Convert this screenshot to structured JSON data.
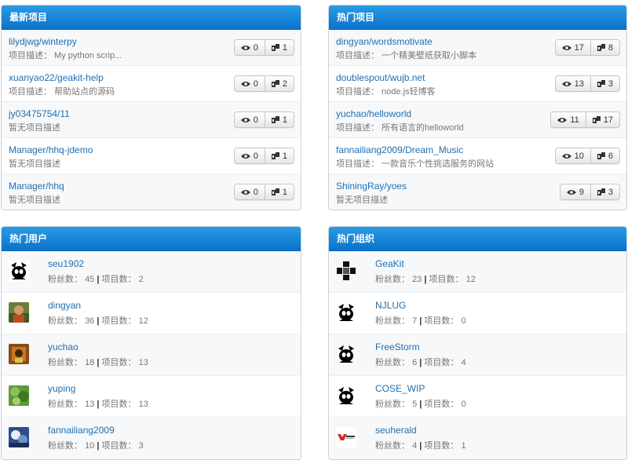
{
  "colors": {
    "header_top": "#2a9be4",
    "header_bottom": "#0a72cc",
    "link": "#1f6fb2"
  },
  "latest": {
    "title": "最新项目",
    "items": [
      {
        "name": "lilydjwg/winterpy",
        "desc": "项目描述：  My python scrip...",
        "watchers": "0",
        "forks": "1"
      },
      {
        "name": "xuanyao22/geakit-help",
        "desc": "项目描述：  帮助站点的源码",
        "watchers": "0",
        "forks": "2"
      },
      {
        "name": "jy03475754/11",
        "desc": "暂无项目描述",
        "watchers": "0",
        "forks": "1"
      },
      {
        "name": "Manager/hhq-jdemo",
        "desc": "暂无项目描述",
        "watchers": "0",
        "forks": "1"
      },
      {
        "name": "Manager/hhq",
        "desc": "暂无项目描述",
        "watchers": "0",
        "forks": "1"
      }
    ]
  },
  "hot": {
    "title": "热门项目",
    "items": [
      {
        "name": "dingyan/wordsmotivate",
        "desc": "项目描述：  一个精美壁纸获取小脚本",
        "watchers": "17",
        "forks": "8"
      },
      {
        "name": "doublespout/wujb.net",
        "desc": "项目描述：  node.js轻博客",
        "watchers": "13",
        "forks": "3"
      },
      {
        "name": "yuchao/helloworld",
        "desc": "项目描述：  所有语言的helloworld",
        "watchers": "11",
        "forks": "17"
      },
      {
        "name": "fannailiang2009/Dream_Music",
        "desc": "项目描述：  一款音乐个性挑选服务的网站",
        "watchers": "10",
        "forks": "6"
      },
      {
        "name": "ShiningRay/yoes",
        "desc": "暂无项目描述",
        "watchers": "9",
        "forks": "3"
      }
    ]
  },
  "users": {
    "title": "热门用户",
    "fans_label": "粉丝数：",
    "projects_label": "项目数：",
    "separator": "|",
    "items": [
      {
        "name": "seu1902",
        "fans": "45",
        "projects": "2",
        "avatar": "identicon-avatar"
      },
      {
        "name": "dingyan",
        "fans": "36",
        "projects": "12",
        "avatar": "photo-avatar"
      },
      {
        "name": "yuchao",
        "fans": "18",
        "projects": "13",
        "avatar": "photo-avatar"
      },
      {
        "name": "yuping",
        "fans": "13",
        "projects": "13",
        "avatar": "photo-avatar"
      },
      {
        "name": "fannailiang2009",
        "fans": "10",
        "projects": "3",
        "avatar": "photo-avatar"
      }
    ]
  },
  "orgs": {
    "title": "热门组织",
    "fans_label": "粉丝数：",
    "projects_label": "项目数：",
    "separator": "|",
    "items": [
      {
        "name": "GeaKit",
        "fans": "23",
        "projects": "12",
        "avatar": "geakit-logo"
      },
      {
        "name": "NJLUG",
        "fans": "7",
        "projects": "0",
        "avatar": "identicon-avatar"
      },
      {
        "name": "FreeStorm",
        "fans": "6",
        "projects": "4",
        "avatar": "identicon-avatar"
      },
      {
        "name": "COSE_WIP",
        "fans": "5",
        "projects": "0",
        "avatar": "identicon-avatar"
      },
      {
        "name": "seuherald",
        "fans": "4",
        "projects": "1",
        "avatar": "seuherald-logo"
      }
    ]
  }
}
